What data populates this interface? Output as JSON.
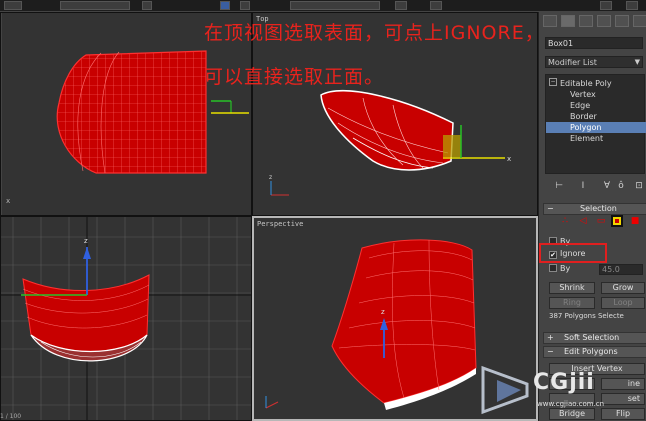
{
  "annotation": {
    "line1": "在顶视图选取表面，可点上IGNORE，",
    "line2": "可以直接选取正面。"
  },
  "viewports": {
    "top_label": "",
    "front_label": "Top",
    "left_label": "",
    "perspective_label": "Perspective"
  },
  "axes": {
    "x": "x",
    "y": "y",
    "z": "z"
  },
  "panel": {
    "object_name": "Box01",
    "modifier_list": "Modifier List",
    "stack": [
      "Editable Poly",
      "Vertex",
      "Edge",
      "Border",
      "Polygon",
      "Element"
    ],
    "stack_selected_index": 4,
    "selection_rollout": "Selection",
    "by_vertex_label": "By",
    "ignore_label": "Ignore",
    "ignore_checked": true,
    "by_angle_label": "By",
    "angle_value": "45.0",
    "shrink": "Shrink",
    "grow": "Grow",
    "ring": "Ring",
    "loop": "Loop",
    "polygons_selected": "387 Polygons Selecte",
    "soft_selection": "Soft Selection",
    "edit_polygons": "Edit Polygons",
    "insert_vertex": "Insert Vertex",
    "extrude": "ine",
    "bevel": "vel",
    "inset": "set",
    "bridge": "Bridge",
    "flip": "Flip"
  },
  "watermark": {
    "brand": "CGjii",
    "url": "www.cgjiao.com.cn"
  },
  "status": "1 / 100",
  "colors": {
    "annotation": "#e8231d",
    "mesh": "#c80000",
    "wire": "#ffffff",
    "highlight_box": "#e01f1f"
  }
}
